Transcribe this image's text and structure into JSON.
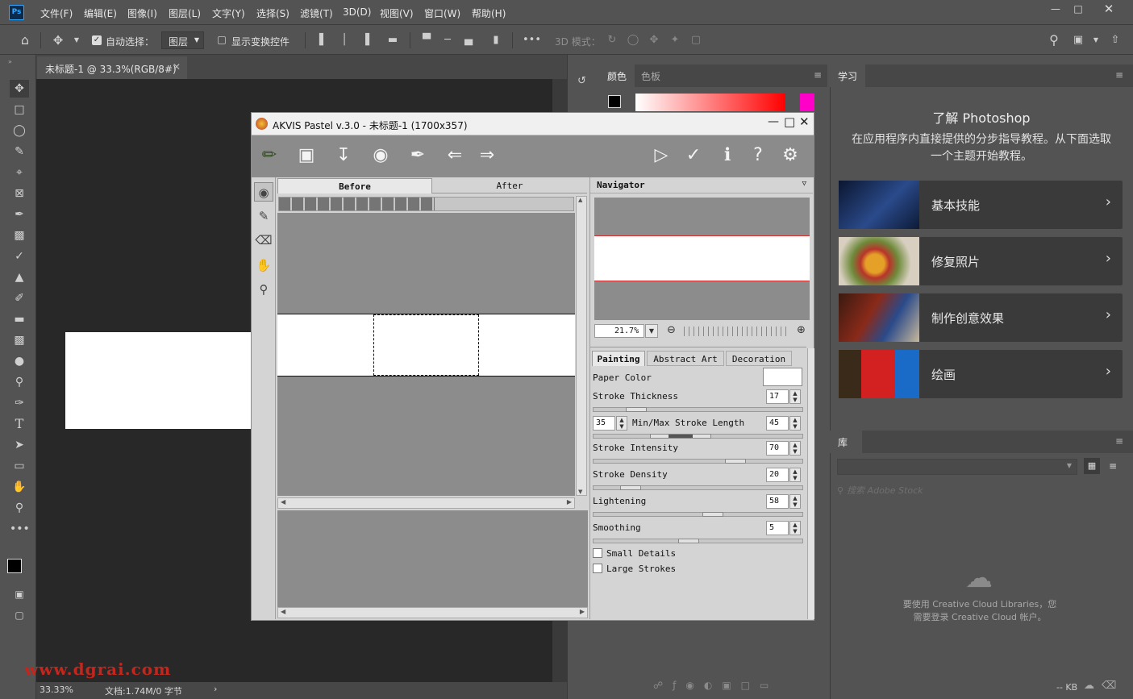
{
  "app": {
    "logo": "Ps",
    "menu": [
      "文件(F)",
      "编辑(E)",
      "图像(I)",
      "图层(L)",
      "文字(Y)",
      "选择(S)",
      "滤镜(T)",
      "3D(D)",
      "视图(V)",
      "窗口(W)",
      "帮助(H)"
    ],
    "window_controls": [
      "minimize-icon",
      "maximize-icon",
      "close-icon"
    ]
  },
  "options_bar": {
    "auto_select_label": "自动选择：",
    "auto_select_checked": true,
    "layer_select_value": "图层",
    "show_transform_label": "显示变换控件",
    "show_transform_checked": false,
    "mode_3d_label": "3D 模式："
  },
  "document": {
    "tab_title": "未标题-1 @ 33.3%(RGB/8#)",
    "zoom": "33.33%",
    "doc_info": "文档:1.74M/0 字节"
  },
  "watermark": "www.dgrai.com",
  "color_panel": {
    "tabs": [
      "颜色",
      "色板"
    ]
  },
  "learn_panel": {
    "tab": "学习",
    "heading": "了解 Photoshop",
    "description": "在应用程序内直接提供的分步指导教程。从下面选取一个主题开始教程。",
    "cards": [
      {
        "label": "基本技能"
      },
      {
        "label": "修复照片"
      },
      {
        "label": "制作创意效果"
      },
      {
        "label": "绘画"
      }
    ]
  },
  "library_panel": {
    "tab": "库",
    "search_placeholder": "搜索 Adobe Stock",
    "message": "要使用 Creative Cloud Libraries，您需要登录 Creative Cloud 帐户。",
    "size": "-- KB"
  },
  "akvis": {
    "title": "AKVIS Pastel v.3.0 - 未标题-1 (1700x357)",
    "view_tabs": [
      "Before",
      "After"
    ],
    "navigator_label": "Navigator",
    "nav_zoom": "21.7%",
    "param_tabs": [
      "Painting",
      "Abstract Art",
      "Decoration"
    ],
    "paper_color_label": "Paper Color",
    "params": [
      {
        "label": "Stroke Thickness",
        "value": "17",
        "pos": 0.17
      },
      {
        "label": "Stroke Intensity",
        "value": "70",
        "pos": 0.7
      },
      {
        "label": "Stroke Density",
        "value": "20",
        "pos": 0.14
      },
      {
        "label": "Lightening",
        "value": "58",
        "pos": 0.58
      },
      {
        "label": "Smoothing",
        "value": "5",
        "pos": 0.45
      }
    ],
    "minmax": {
      "label": "Min/Max Stroke Length",
      "min": "35",
      "max": "45"
    },
    "checkboxes": [
      {
        "label": "Small Details",
        "checked": false
      },
      {
        "label": "Large Strokes",
        "checked": false
      }
    ]
  }
}
